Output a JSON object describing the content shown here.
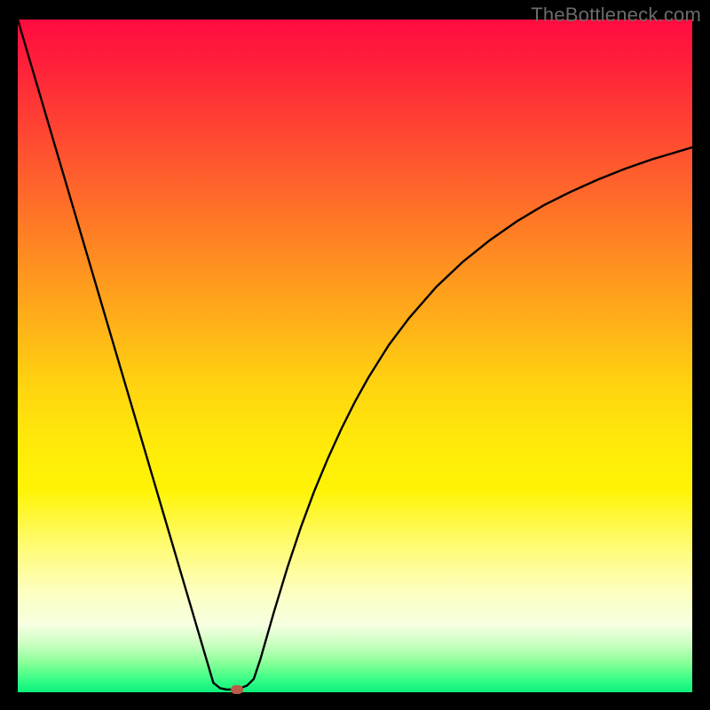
{
  "watermark": "TheBottleneck.com",
  "chart_data": {
    "type": "line",
    "title": "",
    "xlabel": "",
    "ylabel": "",
    "xlim": [
      0,
      100
    ],
    "ylim": [
      0,
      100
    ],
    "series": [
      {
        "name": "curve",
        "x": [
          0,
          2,
          4,
          6,
          8,
          10,
          12,
          14,
          16,
          18,
          20,
          22,
          24,
          26,
          28,
          29,
          30,
          31,
          32,
          33,
          34,
          35,
          36,
          38,
          40,
          42,
          44,
          46,
          48,
          50,
          52,
          55,
          58,
          62,
          66,
          70,
          74,
          78,
          82,
          86,
          90,
          94,
          98,
          100
        ],
        "y": [
          100,
          93.2,
          86.4,
          79.6,
          72.8,
          66.0,
          59.2,
          52.4,
          45.6,
          38.8,
          32.0,
          25.2,
          18.4,
          11.6,
          4.8,
          1.4,
          0.6,
          0.4,
          0.4,
          0.6,
          1.0,
          2.0,
          5.0,
          12.0,
          18.6,
          24.6,
          30.0,
          34.8,
          39.2,
          43.2,
          46.8,
          51.6,
          55.6,
          60.2,
          64.0,
          67.2,
          70.0,
          72.4,
          74.4,
          76.2,
          77.8,
          79.2,
          80.4,
          81.0
        ]
      }
    ],
    "marker": {
      "x": 32.5,
      "y": 0.4,
      "color": "#bb5b4a"
    },
    "gradient_colors_top_to_bottom": [
      "#ff0b3f",
      "#ffb418",
      "#fff406",
      "#0df07a"
    ],
    "axis_ticks_visible": false,
    "grid": false
  }
}
